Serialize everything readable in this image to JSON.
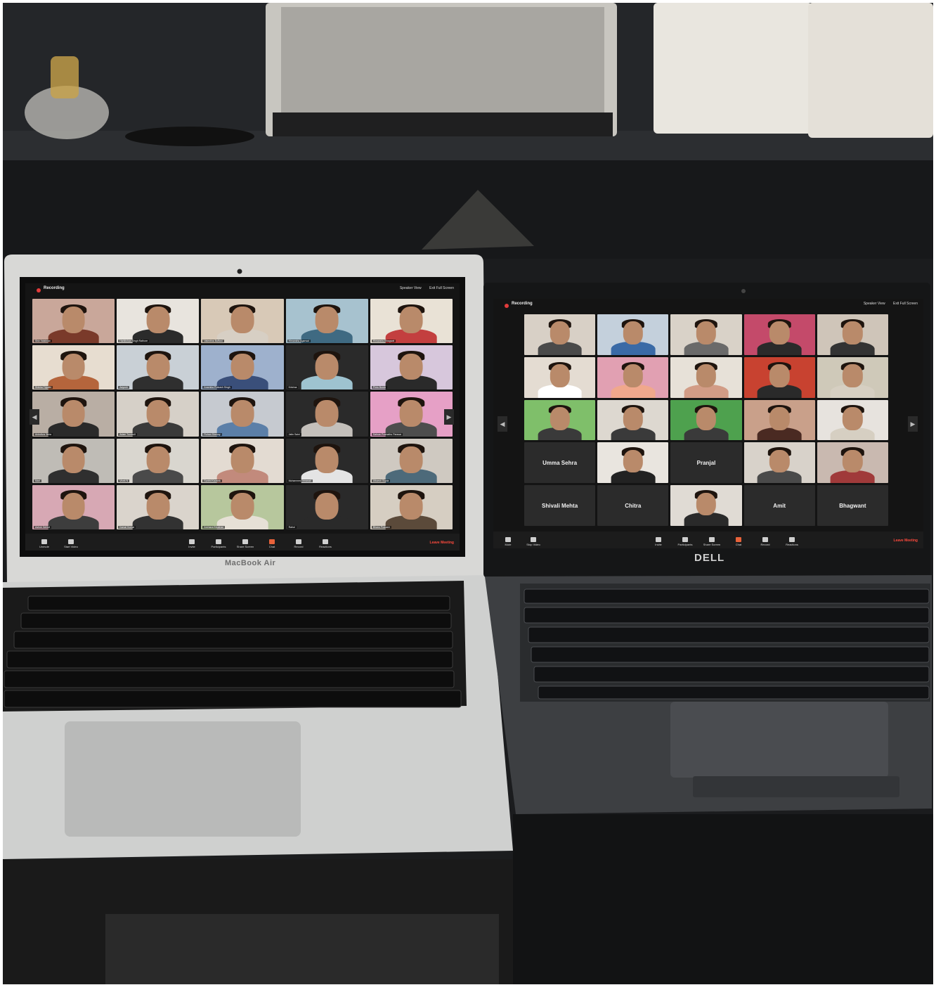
{
  "scene": {
    "description_icons": [
      "laptop-icon",
      "video-grid-icon"
    ]
  },
  "left_laptop": {
    "brand": "MacBook Air",
    "topbar": {
      "recording": "Recording",
      "speaker_view": "Speaker View",
      "exit_full_screen": "Exit Full Screen"
    },
    "tiles": [
      {
        "n": "Shiv Vaishnav",
        "bg": "#c9a79a",
        "shirt": "#7a3a2a"
      },
      {
        "n": "Harikishan Singh Rathore",
        "bg": "#e8e4de",
        "shirt": "#2b2b2b"
      },
      {
        "n": "Valentina Buffoni",
        "bg": "#d8c9b7",
        "shirt": "#d7cfc4"
      },
      {
        "n": "Himanshu Agarwal",
        "bg": "#a7c2cf",
        "shirt": "#3f6a82"
      },
      {
        "n": "Himanshu Bhagwat",
        "bg": "#e9e2d6",
        "shirt": "#c33f3f"
      },
      {
        "n": "Shikha Tripathi",
        "bg": "#e7ddd0",
        "shirt": "#b5653c"
      },
      {
        "n": "Aayush",
        "bg": "#c9d0d6",
        "shirt": "#2f2f2f"
      },
      {
        "n": "Anamika Prakash Singh",
        "bg": "#9eb1cd",
        "shirt": "#3a4f7a"
      },
      {
        "n": "Krishna",
        "bg": "#2a2a2a",
        "shirt": "#9ec3d0"
      },
      {
        "n": "Pintu Bomb",
        "bg": "#d7c7dc",
        "shirt": "#2a2a2a"
      },
      {
        "n": "Anindivor Bera",
        "bg": "#b9aea4",
        "shirt": "#2a2a2a"
      },
      {
        "n": "Adam Turnbull",
        "bg": "#d6d0c8",
        "shirt": "#3a3a3a"
      },
      {
        "n": "Rohan Shenoy",
        "bg": "#c6cad0",
        "shirt": "#5b7fa8"
      },
      {
        "n": "Jatin Saini",
        "bg": "#2a2a2a",
        "shirt": "#c4c0bb"
      },
      {
        "n": "Sahran Pramathu Panwar",
        "bg": "#e6a0c6",
        "shirt": "#4d4d4d"
      },
      {
        "n": "Mari",
        "bg": "#bfbcb6",
        "shirt": "#2f2f2f"
      },
      {
        "n": "Vivek N",
        "bg": "#d9d6cf",
        "shirt": "#4a4a4a"
      },
      {
        "n": "Surbhi Kaushik",
        "bg": "#e3dbd2",
        "shirt": "#c28a7c"
      },
      {
        "n": "Mohammed Imranali",
        "bg": "#2a2a2a",
        "shirt": "#e4e4e4"
      },
      {
        "n": "Utkarsh Gupta",
        "bg": "#cfc9c1",
        "shirt": "#4d6a7a"
      },
      {
        "n": "Ashok Gehlot",
        "bg": "#d7a8b4",
        "shirt": "#3d3d3d"
      },
      {
        "n": "Kamal Kumar",
        "bg": "#dad4cc",
        "shirt": "#323232"
      },
      {
        "n": "Archana Bhushan",
        "bg": "#b7c79d",
        "shirt": "#e6e0d6"
      },
      {
        "n": "Rahul",
        "bg": "#2a2a2a",
        "shirt": "#2a2a2a"
      },
      {
        "n": "Bhanu Prakash",
        "bg": "#d6cec2",
        "shirt": "#5b4a3a"
      }
    ],
    "bottom_bar": [
      "Unmute",
      "Start Video",
      "Invite",
      "Participants",
      "Share Screen",
      "Chat",
      "Record",
      "Reactions"
    ],
    "leave": "Leave Meeting"
  },
  "right_laptop": {
    "brand": "DELL",
    "topbar": {
      "recording": "Recording",
      "speaker_view": "Speaker View",
      "exit_full_screen": "Exit Full Screen"
    },
    "tiles": [
      {
        "n": "",
        "bg": "#d8d0c6",
        "shirt": "#4a4a4a"
      },
      {
        "n": "",
        "bg": "#c4d0dc",
        "shirt": "#3a6aa6"
      },
      {
        "n": "",
        "bg": "#d9d2c8",
        "shirt": "#6a6a6a"
      },
      {
        "n": "",
        "bg": "#c44a6a",
        "shirt": "#2a2a2a"
      },
      {
        "n": "",
        "bg": "#cfc5b9",
        "shirt": "#333333"
      },
      {
        "n": "",
        "bg": "#e4dcd2",
        "shirt": "#ffffff"
      },
      {
        "n": "",
        "bg": "#e1a0b2",
        "shirt": "#f0a88c"
      },
      {
        "n": "",
        "bg": "#e7e1d8",
        "shirt": "#d29c86"
      },
      {
        "n": "",
        "bg": "#c84230",
        "shirt": "#2a2a2a"
      },
      {
        "n": "",
        "bg": "#cfc9b9",
        "shirt": "#d6cfc2"
      },
      {
        "n": "",
        "bg": "#7fbf6a",
        "shirt": "#3a3a3a"
      },
      {
        "n": "",
        "bg": "#ddd8d0",
        "shirt": "#3a3a3a"
      },
      {
        "n": "",
        "bg": "#4ea14e",
        "shirt": "#3a3a3a"
      },
      {
        "n": "",
        "bg": "#c9a08a",
        "shirt": "#4a2a22"
      },
      {
        "n": "",
        "bg": "#e7e3de",
        "shirt": "#d6cfc2"
      },
      {
        "dark": true,
        "big": "Umma Sehra"
      },
      {
        "n": "",
        "bg": "#e9e5df",
        "shirt": "#222222"
      },
      {
        "dark": true,
        "big": "Pranjal"
      },
      {
        "n": "",
        "bg": "#d8d2ca",
        "shirt": "#4a4a4a"
      },
      {
        "n": "",
        "bg": "#c9b9b0",
        "shirt": "#a03a3a"
      },
      {
        "dark": true,
        "big": "Shivali Mehta"
      },
      {
        "dark": true,
        "big": "Chitra"
      },
      {
        "n": "",
        "bg": "#e0dbd4",
        "shirt": "#2a2a2a"
      },
      {
        "dark": true,
        "big": "Amit"
      },
      {
        "dark": true,
        "big": "Bhagwant"
      }
    ],
    "bottom_bar": [
      "Mute",
      "Stop Video",
      "Invite",
      "Participants",
      "Share Screen",
      "Chat",
      "Record",
      "Reactions"
    ],
    "leave": "Leave Meeting"
  },
  "colors": {
    "accent_chat": "#e8623a",
    "leave": "#ff4a3d",
    "recording": "#e23b3b"
  }
}
